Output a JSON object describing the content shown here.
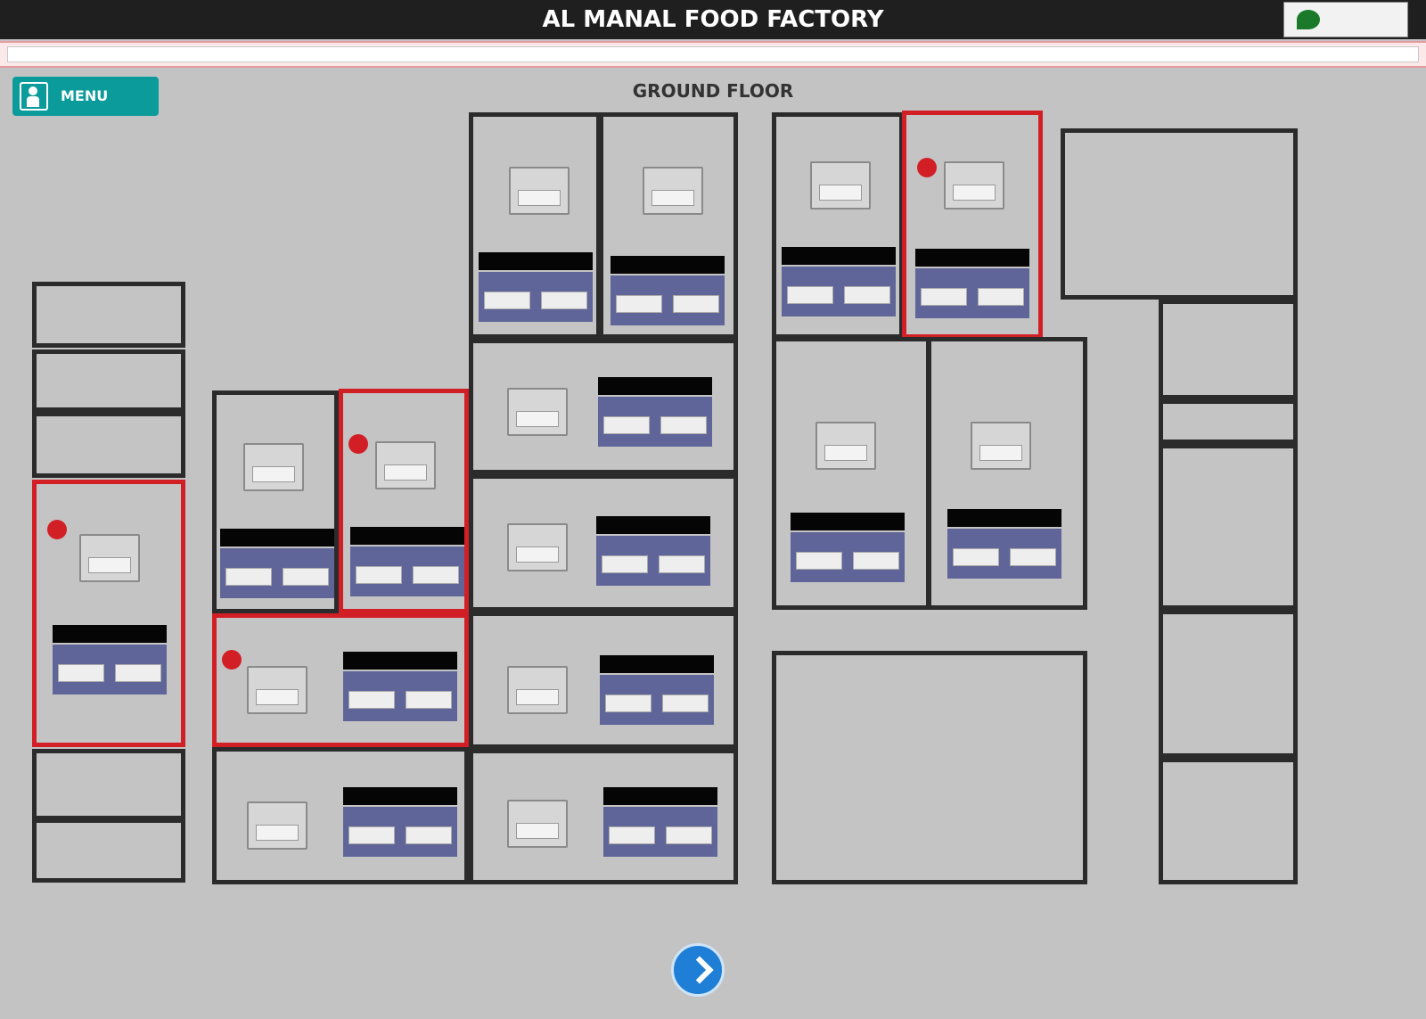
{
  "header": {
    "logo_text": "",
    "user_label": "",
    "title": "AL MANAL FOOD FACTORY",
    "datetime": "",
    "brand_text": ""
  },
  "alarm_bar": {
    "col1": "",
    "col2": "",
    "message": ""
  },
  "menu": {
    "label": "MENU"
  },
  "floor": {
    "title": "GROUND FLOOR"
  },
  "rooms": [],
  "nav": {
    "next_icon": "chevron-right-icon"
  },
  "colors": {
    "alarm": "#d21f26",
    "header_bg": "#1f1f1f",
    "menu_bg": "#0b9b9b",
    "panel_bg": "#5f6598",
    "next_button": "#1f7fd6"
  }
}
